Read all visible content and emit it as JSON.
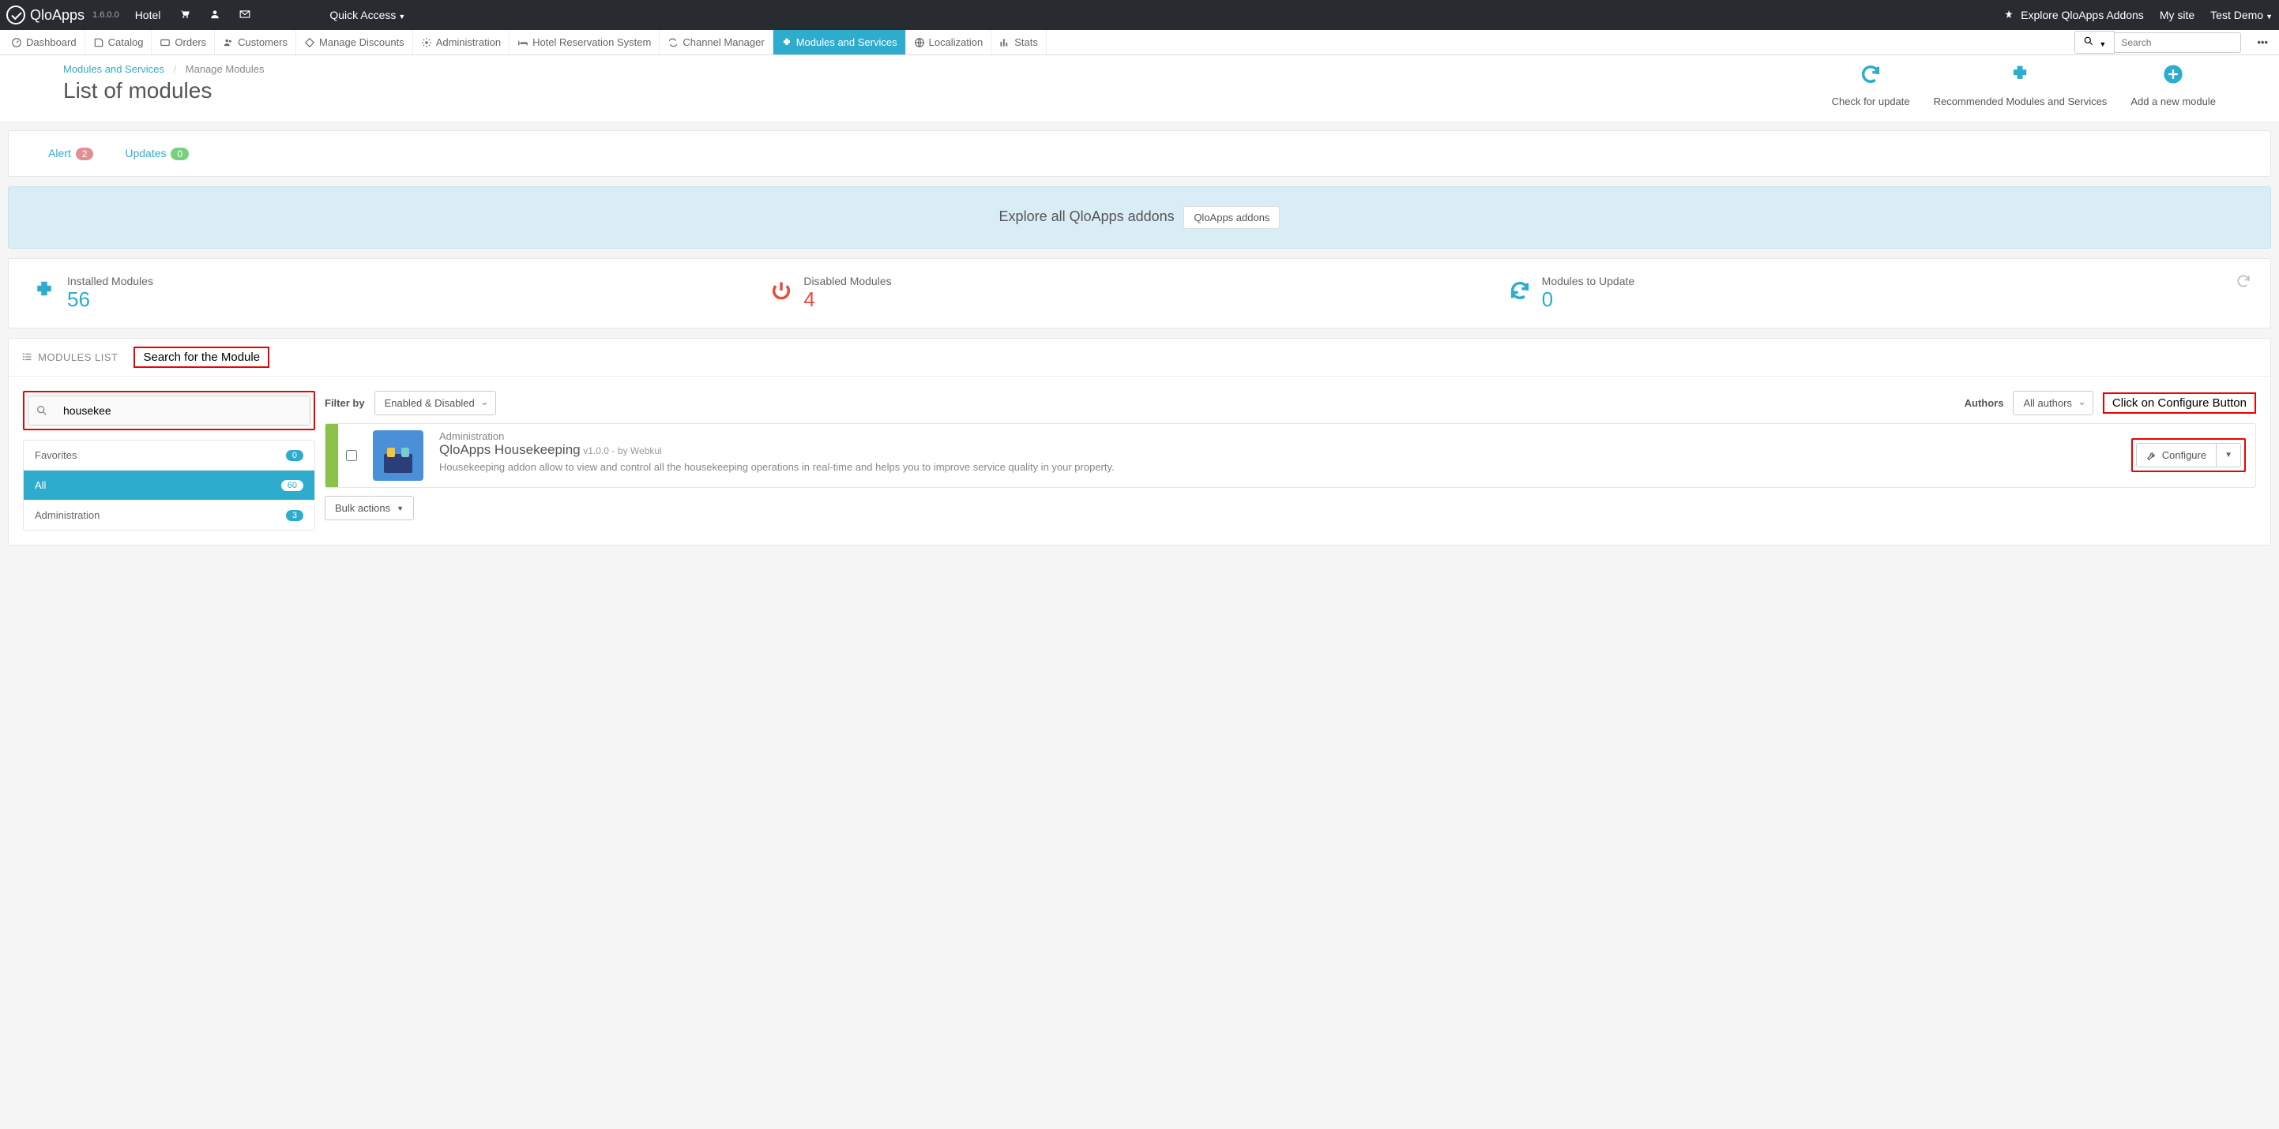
{
  "brand": {
    "name": "QloApps",
    "version": "1.6.0.0"
  },
  "top": {
    "hotel": "Hotel",
    "quick_access": "Quick Access",
    "explore_addons": "Explore QloApps Addons",
    "my_site": "My site",
    "user": "Test Demo"
  },
  "nav": {
    "items": [
      "Dashboard",
      "Catalog",
      "Orders",
      "Customers",
      "Manage Discounts",
      "Administration",
      "Hotel Reservation System",
      "Channel Manager",
      "Modules and Services",
      "Localization",
      "Stats"
    ],
    "active": 8,
    "search_placeholder": "Search"
  },
  "breadcrumb": {
    "a": "Modules and Services",
    "b": "Manage Modules"
  },
  "page_title": "List of modules",
  "head_actions": {
    "check_update": "Check for update",
    "recommended": "Recommended Modules and Services",
    "add_new": "Add a new module"
  },
  "tabs": {
    "alert_label": "Alert",
    "alert_count": "2",
    "updates_label": "Updates",
    "updates_count": "0"
  },
  "explore": {
    "title": "Explore all QloApps addons",
    "button": "QloApps addons"
  },
  "stats": {
    "installed_label": "Installed Modules",
    "installed_count": "56",
    "disabled_label": "Disabled Modules",
    "disabled_count": "4",
    "update_label": "Modules to Update",
    "update_count": "0"
  },
  "mods_list_title": "MODULES LIST",
  "annot_search": "Search for the Module",
  "annot_configure": "Click on Configure Button",
  "search_value": "housekee",
  "categories": [
    {
      "label": "Favorites",
      "count": "0"
    },
    {
      "label": "All",
      "count": "60"
    },
    {
      "label": "Administration",
      "count": "3"
    }
  ],
  "categories_active": 1,
  "filter_by_label": "Filter by",
  "filter_by_value": "Enabled & Disabled",
  "authors_label": "Authors",
  "authors_value": "All authors",
  "module": {
    "category": "Administration",
    "name": "QloApps Housekeeping",
    "version": "v1.0.0 -",
    "by": "by Webkul",
    "description": "Housekeeping addon allow to view and control all the housekeeping operations in real-time and helps you to improve service quality in your property.",
    "configure": "Configure"
  },
  "bulk_actions": "Bulk actions"
}
